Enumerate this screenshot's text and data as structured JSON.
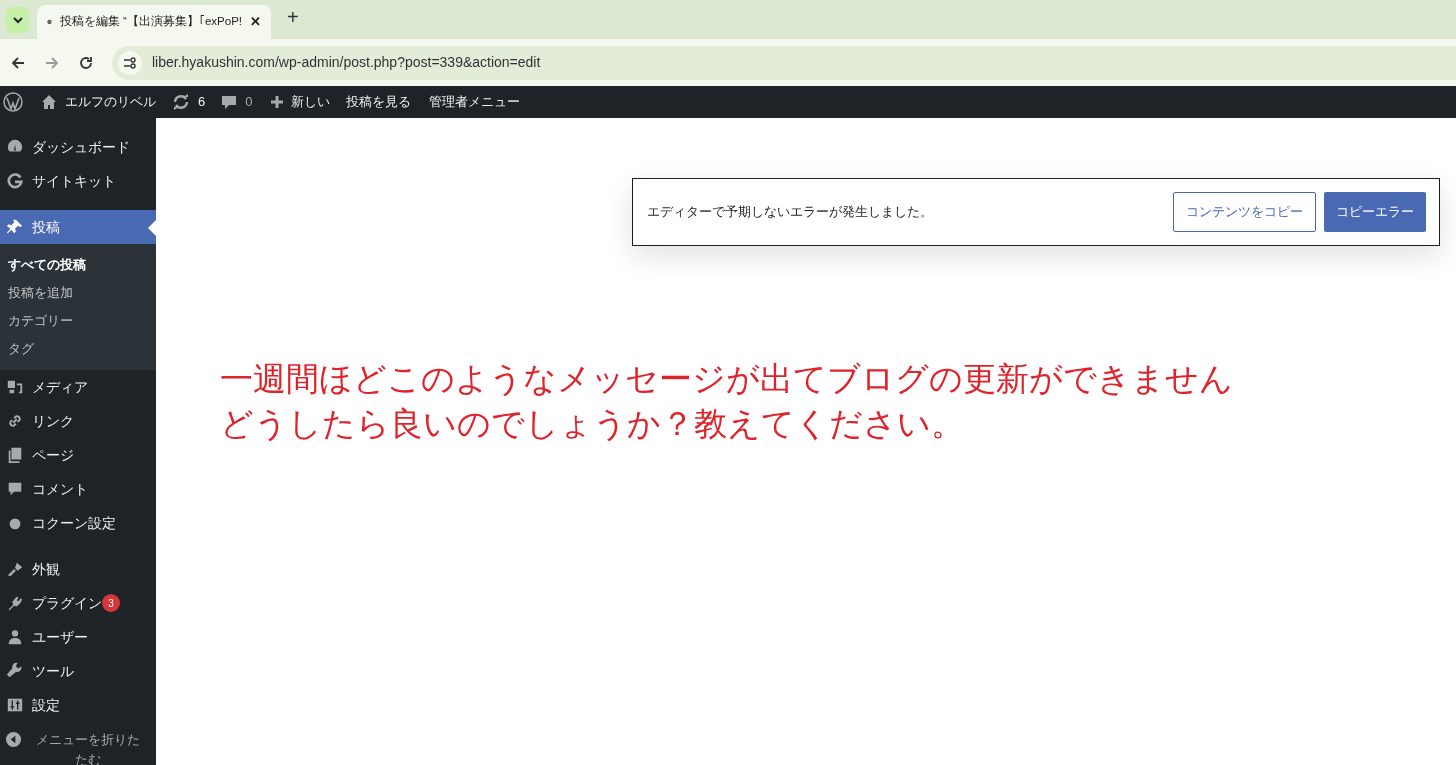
{
  "browser": {
    "tab_title": "投稿を編集 “【出演募集】｢exPoP!",
    "tab_close": "✕",
    "new_tab": "+",
    "url": "liber.hyakushin.com/wp-admin/post.php?post=339&action=edit"
  },
  "admin_bar": {
    "site": "エルフのリベル",
    "updates": "6",
    "comments": "0",
    "new": "新しい",
    "view_post": "投稿を見る",
    "admin_menu": "管理者メニュー"
  },
  "menu_groups": [
    [
      {
        "label": "ダッシュボード",
        "selected": false
      },
      {
        "label": "サイトキット",
        "selected": false
      }
    ],
    [
      {
        "label": "投稿",
        "selected": true,
        "children": [
          {
            "label": "すべての投稿",
            "selected": true
          },
          {
            "label": "投稿を追加",
            "selected": false
          },
          {
            "label": "カテゴリー",
            "selected": false
          },
          {
            "label": "タグ",
            "selected": false
          }
        ]
      },
      {
        "label": "メディア",
        "selected": false
      },
      {
        "label": "リンク",
        "selected": false
      },
      {
        "label": "ページ",
        "selected": false
      },
      {
        "label": "コメント",
        "selected": false
      },
      {
        "label": "コクーン設定",
        "selected": false
      }
    ],
    [
      {
        "label": "外観",
        "selected": false
      },
      {
        "label": "プラグイン",
        "selected": false,
        "badge": "3"
      },
      {
        "label": "ユーザー",
        "selected": false
      },
      {
        "label": "ツール",
        "selected": false
      },
      {
        "label": "設定",
        "selected": false
      }
    ]
  ],
  "collapse_menu": "メニューを折りたたむ",
  "error_notice": {
    "message": "エディターで予期しないエラーが発生しました。",
    "buttons": [
      {
        "label": "コンテンツをコピー",
        "kind": "secondary"
      },
      {
        "label": "コピーエラー",
        "kind": "primary"
      }
    ]
  },
  "annotation": [
    "一週間ほどこのようなメッセージが出てブログの更新ができません",
    "どうしたら良いのでしょうか？教えてください。"
  ]
}
